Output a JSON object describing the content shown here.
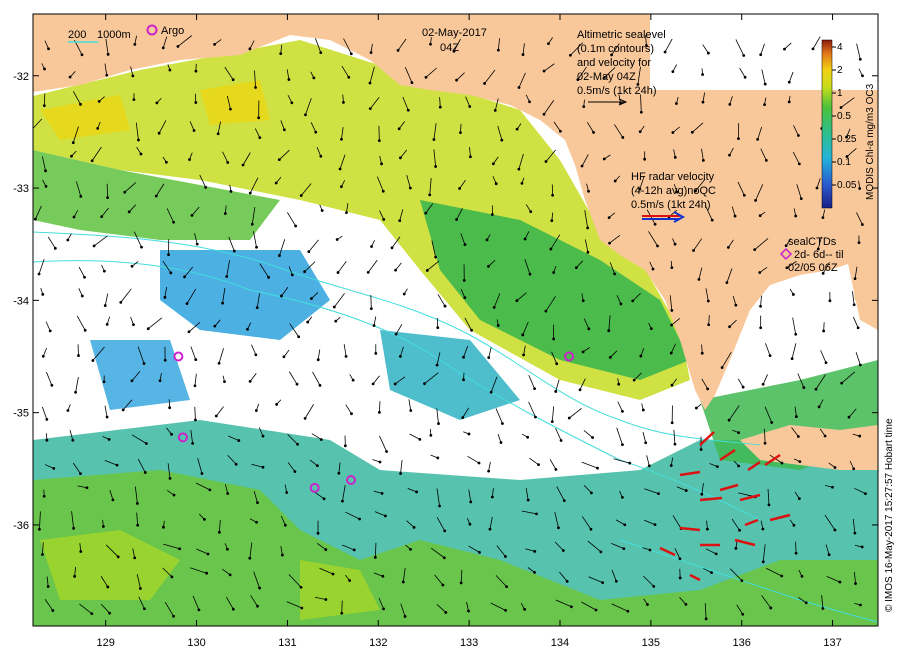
{
  "title": {
    "date": "02-May-2017",
    "time": "04Z"
  },
  "bathymetry_legend": {
    "depth1": "200",
    "depth2": "1000m"
  },
  "argo_legend": "Argo",
  "altimetry_legend": {
    "line1": "Altimetric sealevel",
    "line2": "(0.1m contours)",
    "line3": "and velocity for",
    "line4": "02-May 04Z",
    "line5": "0.5m/s (1kt 24h)"
  },
  "hf_radar_legend": {
    "line1": "HF radar velocity",
    "line2": "(4-12h avg)noQC",
    "line3": "0.5m/s (1kt 24h)"
  },
  "seal_legend": {
    "line1": "sealCTDs",
    "line2": "2d- 6d-- til",
    "line3": "02/05 06Z"
  },
  "colorbar": {
    "label": "MODIS Chl-a mg/m3 OC3",
    "ticks": [
      "4",
      "2",
      "1",
      "0.5",
      "0.25",
      "0.1",
      "0.05"
    ]
  },
  "credit": "© IMOS 16-May-2017 15:27:57 Hobart time",
  "axes": {
    "lon_ticks": [
      "129",
      "130",
      "131",
      "132",
      "133",
      "134",
      "135",
      "136",
      "137"
    ],
    "lat_ticks": [
      "-32",
      "-33",
      "-34",
      "-35",
      "-36"
    ],
    "lon_range": [
      128.2,
      137.5
    ],
    "lat_range": [
      -36.9,
      -31.45
    ]
  },
  "colors": {
    "land": "#f9c89a",
    "chl_high": "#d4e21a",
    "chl_mid": "#3dba4e",
    "chl_low": "#2ab3c8",
    "chl_vlow": "#39a9e0",
    "argo": "#cc22cc",
    "hf_radar": "#dd1111",
    "bathy": "#44dddd"
  },
  "argo_floats": [
    {
      "lon": 129.8,
      "lat": -34.5
    },
    {
      "lon": 129.85,
      "lat": -35.22
    },
    {
      "lon": 131.3,
      "lat": -35.67
    },
    {
      "lon": 131.7,
      "lat": -35.6
    },
    {
      "lon": 134.1,
      "lat": -34.5
    }
  ]
}
